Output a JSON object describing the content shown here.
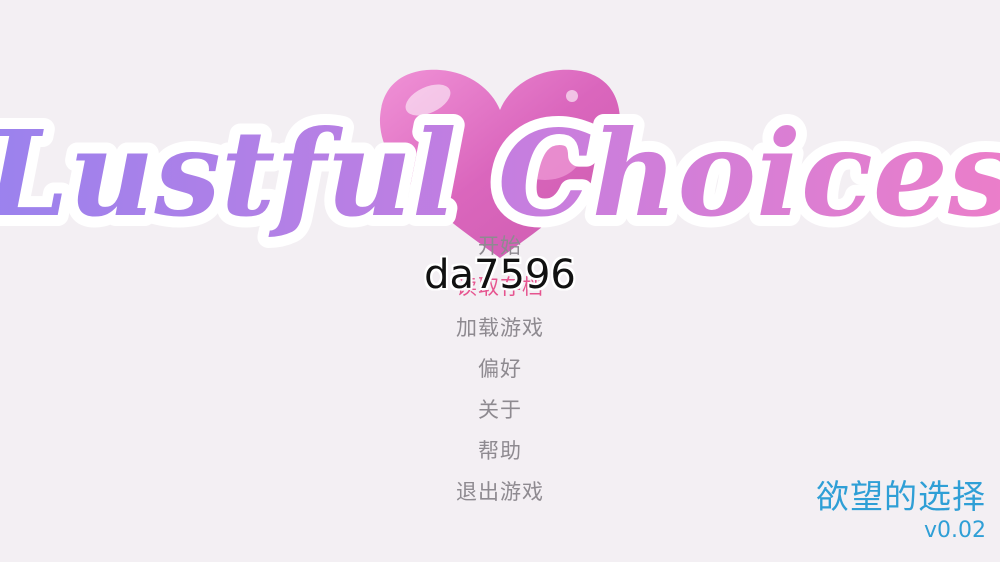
{
  "title": {
    "logo_text": "Lustful Choices"
  },
  "menu": {
    "items": [
      {
        "label": "开始",
        "name": "menu-start-button"
      },
      {
        "label": "加载游戏",
        "name": "menu-load-button"
      },
      {
        "label": "偏好",
        "name": "menu-preferences-button"
      },
      {
        "label": "关于",
        "name": "menu-about-button"
      },
      {
        "label": "帮助",
        "name": "menu-help-button"
      },
      {
        "label": "退出游戏",
        "name": "menu-quit-button"
      }
    ],
    "hidden_item_label": "读取存档"
  },
  "watermark": "da7596",
  "game_name_cn": "欲望的选择",
  "version": "v0.02",
  "colors": {
    "background": "#f3eff3",
    "menu_text": "#8e8a90",
    "menu_hover": "#e6548f",
    "accent_blue": "#2f9fd6",
    "logo_gradient_start": "#9a82ee",
    "logo_gradient_end": "#ec7ec9",
    "heart": "#e46fc0"
  }
}
